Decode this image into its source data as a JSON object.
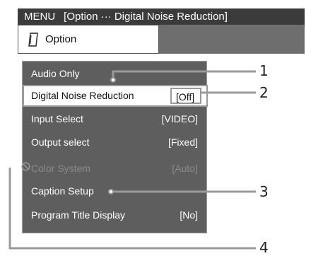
{
  "titlebar": {
    "menu_label": "MENU",
    "path_label": "[Option ··· Digital Noise Reduction]"
  },
  "option_tab": {
    "label": "Option",
    "icon": "option-card-icon"
  },
  "menu": {
    "items": [
      {
        "label": "Audio Only",
        "value": ""
      },
      {
        "label": "Digital Noise Reduction",
        "value": "[Off]"
      },
      {
        "label": "Input Select",
        "value": "[VIDEO]"
      },
      {
        "label": "Output select",
        "value": "[Fixed]"
      },
      {
        "label": "Color System",
        "value": "[Auto]"
      },
      {
        "label": "Caption Setup",
        "value": ""
      },
      {
        "label": "Program Title Display",
        "value": "[No]"
      }
    ],
    "selected_index": 1,
    "disabled_index": 4
  },
  "callouts": [
    "1",
    "2",
    "3",
    "4"
  ],
  "colors": {
    "titlebar_bg": "#3b3b3b",
    "option_bar_bg": "#6e6e6e",
    "panel_bg": "#5e5e5e",
    "selected_bg": "#ffffff",
    "disabled_text": "#8a8a8a"
  }
}
